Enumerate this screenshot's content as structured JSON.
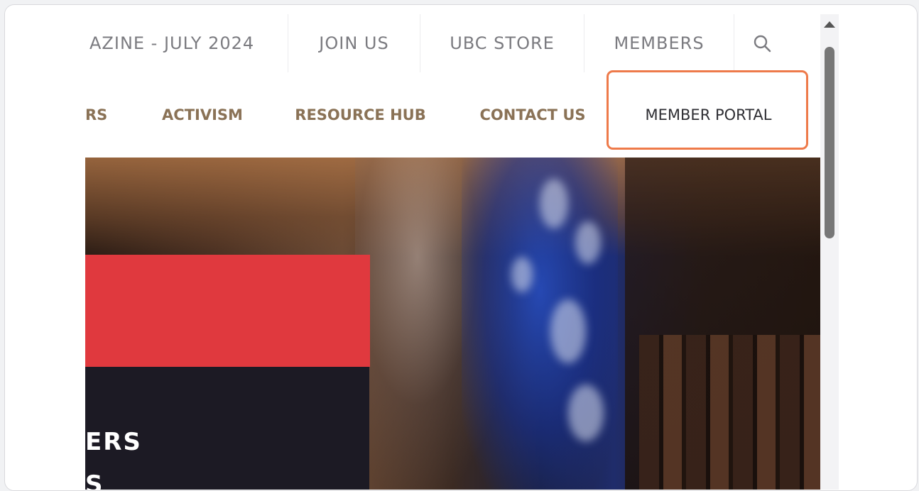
{
  "topbar": {
    "items": [
      {
        "label": "AZINE - JULY 2024"
      },
      {
        "label": "JOIN US"
      },
      {
        "label": "UBC STORE"
      },
      {
        "label": "MEMBERS"
      }
    ],
    "search_icon": "search-icon"
  },
  "mainnav": {
    "items": [
      {
        "label": "RS"
      },
      {
        "label": "ACTIVISM"
      },
      {
        "label": "RESOURCE HUB"
      },
      {
        "label": "CONTACT US"
      },
      {
        "label": "MEMBER PORTAL"
      }
    ],
    "highlight_color": "#ee7a4a"
  },
  "hero": {
    "headline_line1": "ERS",
    "headline_line2": "S",
    "banner_color": "#e0393e"
  }
}
